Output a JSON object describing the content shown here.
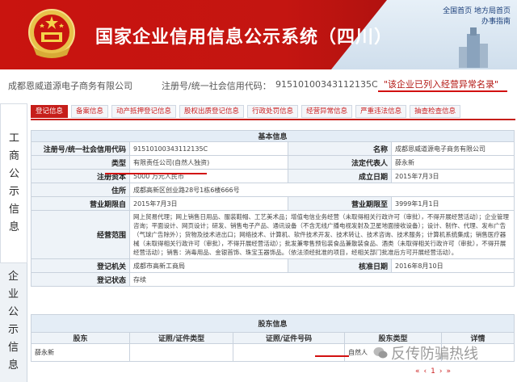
{
  "header": {
    "title": "国家企业信用信息公示系统（四川）",
    "links": [
      "全国首页",
      "地方局首页",
      "办事指南"
    ]
  },
  "company": {
    "name": "成都恩威道源电子商务有限公司",
    "reg_label": "注册号/统一社会信用代码：",
    "reg_value": "91510100343112135C",
    "abnormal": "\"该企业已列入经营异常名录\""
  },
  "side": {
    "gongshang": "工商公示信息",
    "qiye": "企业公示信息"
  },
  "tabs": [
    "登记信息",
    "备案信息",
    "动产抵押登记信息",
    "股权出质登记信息",
    "行政处罚信息",
    "经营异常信息",
    "严重违法信息",
    "抽查检查信息"
  ],
  "basic": {
    "title": "基本信息",
    "rows": {
      "reg_code_label": "注册号/统一社会信用代码",
      "reg_code_value": "91510100343112135C",
      "name_label": "名称",
      "name_value": "成都恩威道源电子商务有限公司",
      "type_label": "类型",
      "type_value": "有限责任公司(自然人独资)",
      "rep_label": "法定代表人",
      "rep_value": "薛永新",
      "capital_label": "注册资本",
      "capital_value": "5000 万元人民币",
      "date_label": "成立日期",
      "date_value": "2015年7月3日",
      "address_label": "住所",
      "address_value": "成都高新区创业路28号1栋6楼666号",
      "term_from_label": "营业期限自",
      "term_from_value": "2015年7月3日",
      "term_to_label": "营业期限至",
      "term_to_value": "3999年1月1日",
      "scope_label": "经营范围",
      "scope_value": "网上贸易代理；网上销售日用品、服装鞋帽、工艺美术品；增值电信业务经营（未取得相关行政许可（审批），不得开展经营活动）；企业管理咨询；平面设计、网页设计；研发、销售电子产品、通讯设备（不含无线广播电视发射及卫星地面接收设备）；设计、制作、代理、发布广告（气球广告除外）；货物及技术进出口；网络技术、计算机、软件技术开发、技术转让、技术咨询、技术服务；计算机系统集成；销售医疗器械（未取得相关行政许可（审批），不得开展经营活动）；批发兼零售预包装食品兼散装食品、酒类（未取得相关行政许可（审批），不得开展经营活动）；销售：消毒用品、金银首饰、珠宝玉器饰品。（依法须经批准的项目，经相关部门批准后方可开展经营活动）。",
      "authority_label": "登记机关",
      "authority_value": "成都市高新工商局",
      "approve_label": "核准日期",
      "approve_value": "2016年8月10日",
      "status_label": "登记状态",
      "status_value": "存续"
    }
  },
  "shareholders": {
    "title": "股东信息",
    "headers": [
      "股东",
      "证照/证件类型",
      "证照/证件号码",
      "股东类型",
      "详情"
    ],
    "rows": [
      {
        "name": "薛永新",
        "id_type": "",
        "id_no": "",
        "type": "自然人",
        "detail": ""
      }
    ]
  },
  "watermark": "反传防骗热线",
  "pager": [
    "«",
    "‹",
    "1",
    "›",
    "»"
  ],
  "colors": {
    "brand_red": "#c61e1a",
    "highlight": "#d21010",
    "label_bg": "#eef3f8"
  }
}
